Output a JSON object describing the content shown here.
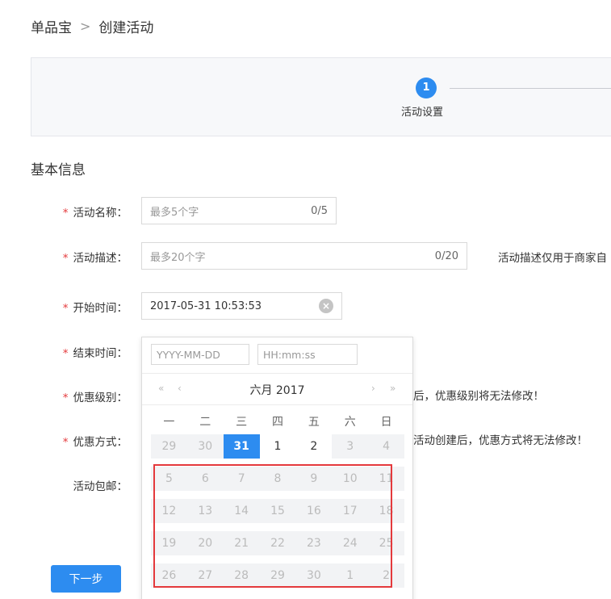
{
  "breadcrumb": {
    "root": "单品宝",
    "separator": ">",
    "current": "创建活动"
  },
  "steps": {
    "number": "1",
    "label": "活动设置"
  },
  "section": {
    "title": "基本信息"
  },
  "form": {
    "required_mark": "*",
    "name": {
      "label": "活动名称：",
      "placeholder": "最多5个字",
      "count": "0/5"
    },
    "desc": {
      "label": "活动描述：",
      "placeholder": "最多20个字",
      "count": "0/20",
      "hint": "活动描述仅用于商家自"
    },
    "start": {
      "label": "开始时间：",
      "value": "2017-05-31 10:53:53"
    },
    "end": {
      "label": "结束时间："
    },
    "level": {
      "label": "优惠级别：",
      "hint": "后，优惠级别将无法修改！"
    },
    "method": {
      "label": "优惠方式：",
      "hint": "活动创建后，优惠方式将无法修改！"
    },
    "shipping": {
      "label": "活动包邮："
    }
  },
  "next_button": "下一步",
  "datepicker": {
    "date_placeholder": "YYYY-MM-DD",
    "time_placeholder": "HH:mm:ss",
    "prev_year": "«",
    "prev_month": "‹",
    "title": "六月  2017",
    "next_month": "›",
    "next_year": "»",
    "weekdays": [
      "一",
      "二",
      "三",
      "四",
      "五",
      "六",
      "日"
    ],
    "weeks": [
      [
        "29",
        "30",
        "31",
        "1",
        "2",
        "3",
        "4"
      ],
      [
        "5",
        "6",
        "7",
        "8",
        "9",
        "10",
        "11"
      ],
      [
        "12",
        "13",
        "14",
        "15",
        "16",
        "17",
        "18"
      ],
      [
        "19",
        "20",
        "21",
        "22",
        "23",
        "24",
        "25"
      ],
      [
        "26",
        "27",
        "28",
        "29",
        "30",
        "1",
        "2"
      ]
    ],
    "selected": "31"
  }
}
